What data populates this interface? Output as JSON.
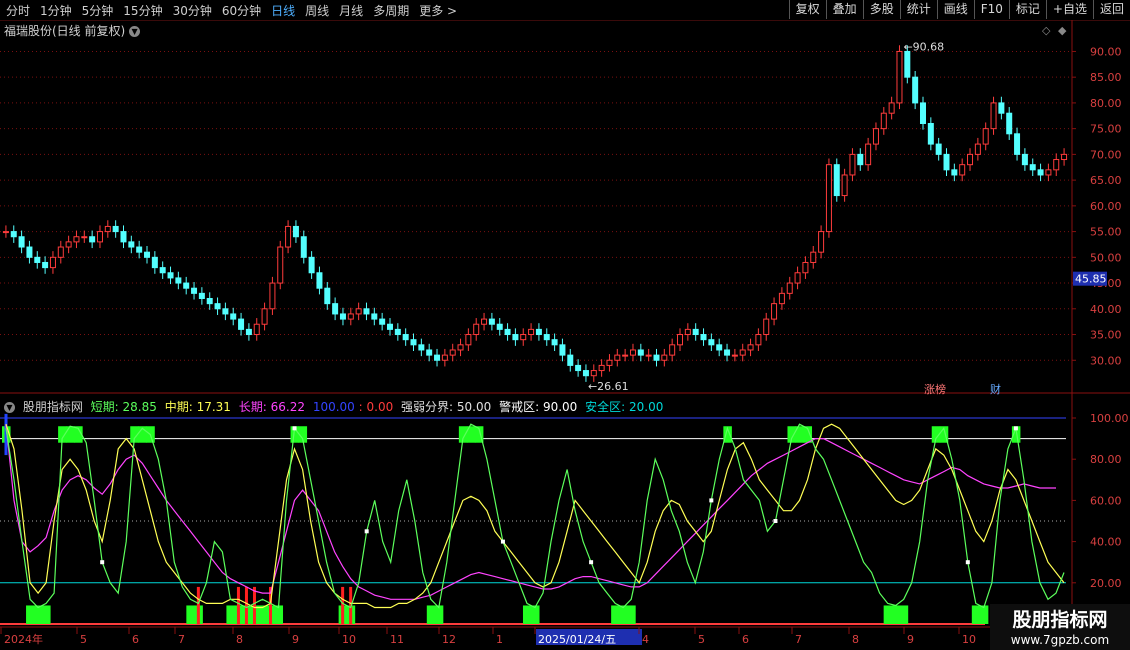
{
  "toolbar": {
    "periods": [
      "分时",
      "1分钟",
      "5分钟",
      "15分钟",
      "30分钟",
      "60分钟",
      "日线",
      "周线",
      "月线",
      "多周期",
      "更多 >"
    ],
    "active_period": "日线",
    "actions": [
      "复权",
      "叠加",
      "多股",
      "统计",
      "画线",
      "F10",
      "标记",
      "+自选",
      "返回"
    ]
  },
  "main": {
    "title": "福瑞股份(日线 前复权)",
    "price_labels": [
      "90.00",
      "85.00",
      "80.00",
      "75.00",
      "70.00",
      "65.00",
      "60.00",
      "55.00",
      "50.00",
      "45.00",
      "40.00",
      "35.00",
      "30.00"
    ],
    "price_values": [
      90,
      85,
      80,
      75,
      70,
      65,
      60,
      55,
      50,
      45,
      40,
      35,
      30
    ],
    "current_price": "45.85",
    "high_label": "90.68",
    "low_label": "26.61",
    "badge_zhang": "涨榜",
    "badge_cai": "财"
  },
  "sub": {
    "name": "股朋指标网",
    "short_label": "短期: 28.85",
    "mid_label": "中期: 17.31",
    "long_label": "长期: 66.22",
    "hundred_label": "100.00",
    "zero_label": ": 0.00",
    "divide_label": "强弱分界: 50.00",
    "warn_label": "警戒区: 90.00",
    "safe_label": "安全区: 20.00",
    "y_labels": [
      "100.00",
      "80.00",
      "60.00",
      "40.00",
      "20.00"
    ],
    "y_values": [
      100,
      80,
      60,
      40,
      20
    ]
  },
  "xaxis": {
    "labels": [
      "2024年",
      "5",
      "6",
      "7",
      "8",
      "9",
      "10",
      "11",
      "12",
      "1",
      "2025/01/24/五",
      "4",
      "5",
      "6",
      "7",
      "8",
      "9",
      "10"
    ]
  },
  "watermark": {
    "title": "股朋指标网",
    "url": "www.7gpzb.com"
  },
  "colors": {
    "up": "#ff3c3c",
    "down": "#54ffff",
    "short": "#5cff5c",
    "mid": "#ffff55",
    "long": "#ff44ff",
    "warn": "#ffffff",
    "safe": "#00d8d8",
    "top": "#3344ff"
  },
  "chart_data": {
    "type": "candlestick",
    "price_range": [
      25,
      93
    ],
    "price_series": [
      55,
      54,
      52,
      50,
      49,
      48,
      50,
      52,
      53,
      54,
      54,
      53,
      55,
      56,
      55,
      53,
      52,
      51,
      50,
      48,
      47,
      46,
      45,
      44,
      43,
      42,
      41,
      40,
      39,
      38,
      36,
      35,
      37,
      40,
      45,
      52,
      56,
      54,
      50,
      47,
      44,
      41,
      39,
      38,
      39,
      40,
      39,
      38,
      37,
      36,
      35,
      34,
      33,
      32,
      31,
      30,
      31,
      32,
      33,
      35,
      37,
      38,
      37,
      36,
      35,
      34,
      35,
      36,
      35,
      34,
      33,
      31,
      29,
      28,
      27,
      28,
      29,
      30,
      31,
      31,
      32,
      31,
      31,
      30,
      31,
      33,
      35,
      36,
      35,
      34,
      33,
      32,
      31,
      31,
      32,
      33,
      35,
      38,
      41,
      43,
      45,
      47,
      49,
      51,
      55,
      68,
      62,
      66,
      70,
      68,
      72,
      75,
      78,
      80,
      90,
      85,
      80,
      76,
      72,
      70,
      67,
      66,
      68,
      70,
      72,
      75,
      80,
      78,
      74,
      70,
      68,
      67,
      66,
      67,
      69,
      70
    ],
    "short_series": [
      95,
      70,
      40,
      12,
      8,
      10,
      15,
      90,
      96,
      95,
      88,
      60,
      30,
      20,
      15,
      40,
      90,
      95,
      92,
      80,
      60,
      30,
      18,
      12,
      10,
      20,
      40,
      35,
      12,
      10,
      8,
      10,
      12,
      10,
      8,
      60,
      95,
      90,
      70,
      50,
      30,
      15,
      10,
      8,
      20,
      45,
      60,
      40,
      30,
      55,
      70,
      50,
      25,
      12,
      8,
      30,
      60,
      90,
      97,
      95,
      80,
      60,
      40,
      30,
      20,
      10,
      8,
      15,
      40,
      60,
      75,
      55,
      40,
      30,
      20,
      15,
      10,
      8,
      12,
      30,
      60,
      80,
      70,
      55,
      45,
      30,
      20,
      35,
      60,
      80,
      95,
      85,
      70,
      65,
      60,
      45,
      50,
      70,
      90,
      97,
      95,
      85,
      80,
      70,
      60,
      50,
      40,
      30,
      25,
      15,
      10,
      9,
      12,
      20,
      40,
      70,
      90,
      95,
      80,
      60,
      30,
      10,
      8,
      20,
      60,
      85,
      95,
      70,
      40,
      20,
      12,
      15,
      25
    ],
    "mid_series": [
      97,
      85,
      55,
      20,
      15,
      20,
      50,
      75,
      80,
      75,
      65,
      50,
      40,
      60,
      85,
      90,
      85,
      70,
      55,
      40,
      30,
      25,
      20,
      15,
      12,
      10,
      10,
      10,
      12,
      12,
      10,
      8,
      8,
      10,
      40,
      70,
      85,
      75,
      50,
      30,
      20,
      15,
      12,
      10,
      10,
      10,
      8,
      8,
      8,
      10,
      10,
      12,
      15,
      20,
      30,
      40,
      50,
      60,
      62,
      60,
      55,
      45,
      40,
      35,
      30,
      25,
      20,
      18,
      20,
      30,
      45,
      60,
      55,
      50,
      45,
      40,
      35,
      30,
      25,
      20,
      30,
      45,
      55,
      60,
      58,
      50,
      45,
      40,
      45,
      60,
      75,
      85,
      88,
      80,
      70,
      65,
      60,
      55,
      55,
      60,
      70,
      85,
      95,
      97,
      95,
      90,
      85,
      80,
      75,
      70,
      65,
      60,
      58,
      60,
      65,
      75,
      85,
      82,
      75,
      65,
      55,
      45,
      40,
      50,
      65,
      75,
      70,
      60,
      50,
      40,
      30,
      25,
      20
    ],
    "long_series": [
      97,
      60,
      40,
      35,
      38,
      42,
      55,
      65,
      70,
      72,
      70,
      66,
      63,
      68,
      75,
      80,
      82,
      78,
      72,
      66,
      60,
      55,
      50,
      45,
      40,
      35,
      30,
      25,
      22,
      20,
      18,
      16,
      15,
      15,
      30,
      45,
      60,
      65,
      60,
      55,
      45,
      35,
      28,
      22,
      18,
      16,
      14,
      13,
      12,
      12,
      12,
      12,
      13,
      14,
      16,
      18,
      20,
      22,
      24,
      25,
      24,
      23,
      22,
      21,
      20,
      19,
      18,
      17,
      17,
      18,
      20,
      22,
      23,
      23,
      22,
      21,
      20,
      19,
      18,
      18,
      20,
      24,
      28,
      32,
      36,
      40,
      44,
      48,
      52,
      56,
      60,
      64,
      68,
      72,
      75,
      78,
      80,
      82,
      84,
      86,
      88,
      90,
      90,
      88,
      86,
      84,
      82,
      80,
      78,
      76,
      74,
      72,
      70,
      69,
      68,
      70,
      72,
      74,
      76,
      75,
      72,
      70,
      68,
      67,
      66,
      66,
      67,
      68,
      67,
      66,
      66,
      66
    ]
  }
}
